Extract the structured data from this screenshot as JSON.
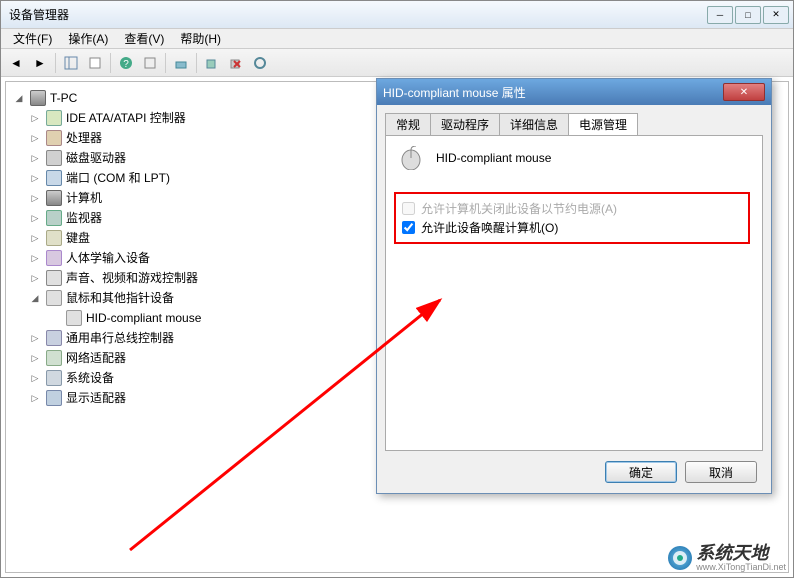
{
  "window": {
    "title": "设备管理器",
    "menu": [
      "文件(F)",
      "操作(A)",
      "查看(V)",
      "帮助(H)"
    ]
  },
  "tree": {
    "root": "T-PC",
    "nodes": [
      {
        "label": "IDE ATA/ATAPI 控制器",
        "expanded": false
      },
      {
        "label": "处理器",
        "expanded": false
      },
      {
        "label": "磁盘驱动器",
        "expanded": false
      },
      {
        "label": "端口 (COM 和 LPT)",
        "expanded": false
      },
      {
        "label": "计算机",
        "expanded": false
      },
      {
        "label": "监视器",
        "expanded": false
      },
      {
        "label": "键盘",
        "expanded": false
      },
      {
        "label": "人体学输入设备",
        "expanded": false
      },
      {
        "label": "声音、视频和游戏控制器",
        "expanded": false
      },
      {
        "label": "鼠标和其他指针设备",
        "expanded": true,
        "children": [
          {
            "label": "HID-compliant mouse"
          }
        ]
      },
      {
        "label": "通用串行总线控制器",
        "expanded": false
      },
      {
        "label": "网络适配器",
        "expanded": false
      },
      {
        "label": "系统设备",
        "expanded": false
      },
      {
        "label": "显示适配器",
        "expanded": false
      }
    ]
  },
  "dialog": {
    "title": "HID-compliant mouse 属性",
    "tabs": [
      "常规",
      "驱动程序",
      "详细信息",
      "电源管理"
    ],
    "active_tab": 3,
    "device_name": "HID-compliant mouse",
    "option_disabled": "允许计算机关闭此设备以节约电源(A)",
    "option_enabled": "允许此设备唤醒计算机(O)",
    "ok": "确定",
    "cancel": "取消"
  },
  "watermark": {
    "brand": "系统天地",
    "url": "www.XiTongTianDi.net"
  }
}
